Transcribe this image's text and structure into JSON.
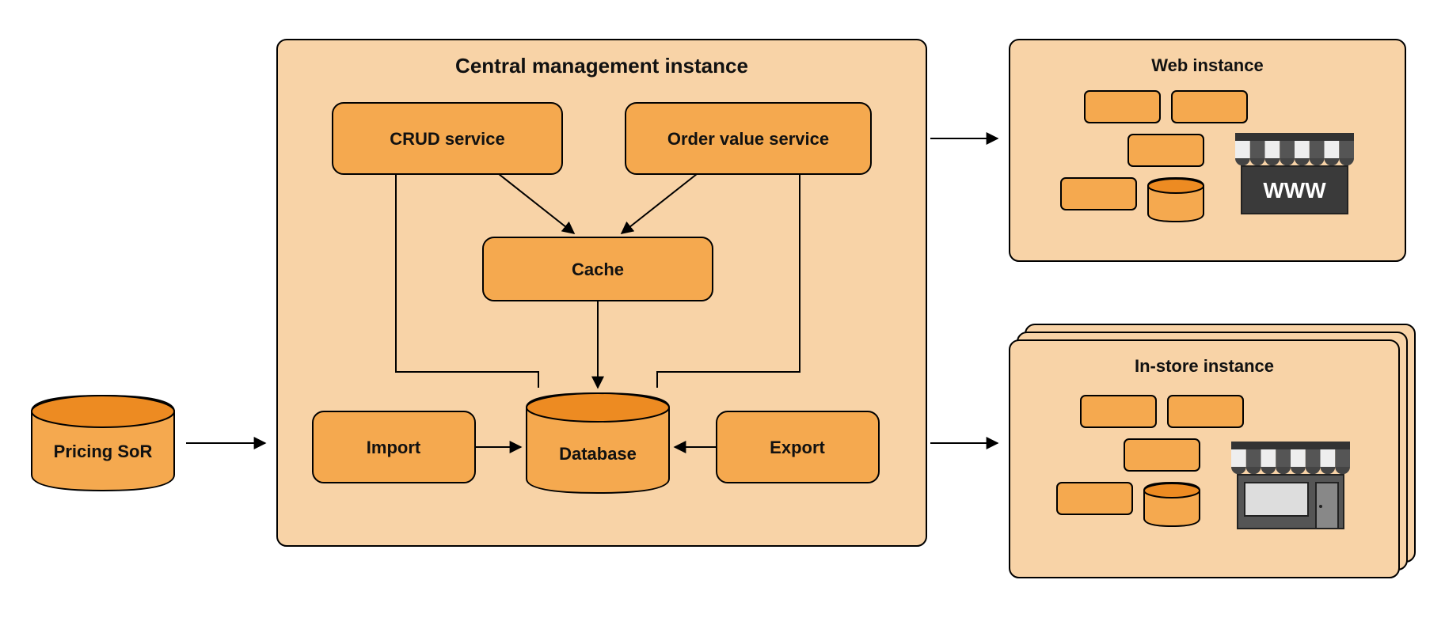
{
  "diagram": {
    "pricing_sor": "Pricing SoR",
    "central": {
      "title": "Central management instance",
      "crud": "CRUD service",
      "order_value": "Order value service",
      "cache": "Cache",
      "import": "Import",
      "database": "Database",
      "export": "Export"
    },
    "web_instance": "Web instance",
    "in_store_instance": "In-store instance",
    "www_label": "WWW"
  },
  "colors": {
    "box": "#f5a94f",
    "container": "#f8d3a7",
    "cylinder_top": "#ed8b22"
  }
}
